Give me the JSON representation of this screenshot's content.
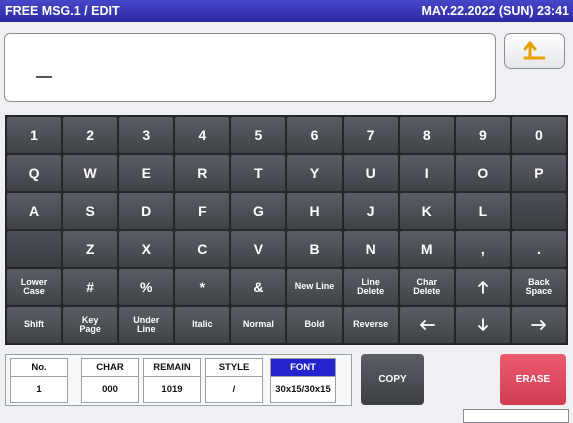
{
  "header": {
    "title": "FREE MSG.1 / EDIT",
    "datetime": "MAY.22.2022 (SUN) 23:41"
  },
  "editor": {
    "text": "",
    "back_icon": "return-arrow-icon"
  },
  "keyboard": {
    "rows": [
      [
        {
          "label": "1"
        },
        {
          "label": "2"
        },
        {
          "label": "3"
        },
        {
          "label": "4"
        },
        {
          "label": "5"
        },
        {
          "label": "6"
        },
        {
          "label": "7"
        },
        {
          "label": "8"
        },
        {
          "label": "9"
        },
        {
          "label": "0"
        }
      ],
      [
        {
          "label": "Q"
        },
        {
          "label": "W"
        },
        {
          "label": "E"
        },
        {
          "label": "R"
        },
        {
          "label": "T"
        },
        {
          "label": "Y"
        },
        {
          "label": "U"
        },
        {
          "label": "I"
        },
        {
          "label": "O"
        },
        {
          "label": "P"
        }
      ],
      [
        {
          "label": "A"
        },
        {
          "label": "S"
        },
        {
          "label": "D"
        },
        {
          "label": "F"
        },
        {
          "label": "G"
        },
        {
          "label": "H"
        },
        {
          "label": "J"
        },
        {
          "label": "K"
        },
        {
          "label": "L"
        },
        {
          "label": ""
        }
      ],
      [
        {
          "label": ""
        },
        {
          "label": "Z"
        },
        {
          "label": "X"
        },
        {
          "label": "C"
        },
        {
          "label": "V"
        },
        {
          "label": "B"
        },
        {
          "label": "N"
        },
        {
          "label": "M"
        },
        {
          "label": ","
        },
        {
          "label": "."
        }
      ],
      [
        {
          "label": "Lower\nCase",
          "small": true
        },
        {
          "label": "#"
        },
        {
          "label": "%"
        },
        {
          "label": "*"
        },
        {
          "label": "&"
        },
        {
          "label": "New Line",
          "small": true
        },
        {
          "label": "Line\nDelete",
          "small": true
        },
        {
          "label": "Char\nDelete",
          "small": true
        },
        {
          "label": "",
          "icon": "arrow-up-icon"
        },
        {
          "label": "Back\nSpace",
          "small": true
        }
      ],
      [
        {
          "label": "Shift",
          "small": true
        },
        {
          "label": "Key\nPage",
          "small": true
        },
        {
          "label": "Under\nLine",
          "small": true
        },
        {
          "label": "Italic",
          "small": true
        },
        {
          "label": "Normal",
          "small": true
        },
        {
          "label": "Bold",
          "small": true
        },
        {
          "label": "Reverse",
          "small": true
        },
        {
          "label": "",
          "icon": "arrow-left-icon"
        },
        {
          "label": "",
          "icon": "arrow-down-icon"
        },
        {
          "label": "",
          "icon": "arrow-right-icon"
        }
      ]
    ]
  },
  "info": {
    "no": {
      "header": "No.",
      "value": "1"
    },
    "char": {
      "header": "CHAR",
      "value": "000"
    },
    "remain": {
      "header": "REMAIN",
      "value": "1019"
    },
    "style": {
      "header": "STYLE",
      "value": "/"
    },
    "font": {
      "header": "FONT",
      "value": "30x15/30x15"
    }
  },
  "actions": {
    "copy_label": "COPY",
    "erase_label": "ERASE"
  },
  "colors": {
    "title_bar": "#2b2ba6",
    "key": "#4a4d52",
    "font_header": "#2323d0",
    "erase": "#e04a60"
  }
}
